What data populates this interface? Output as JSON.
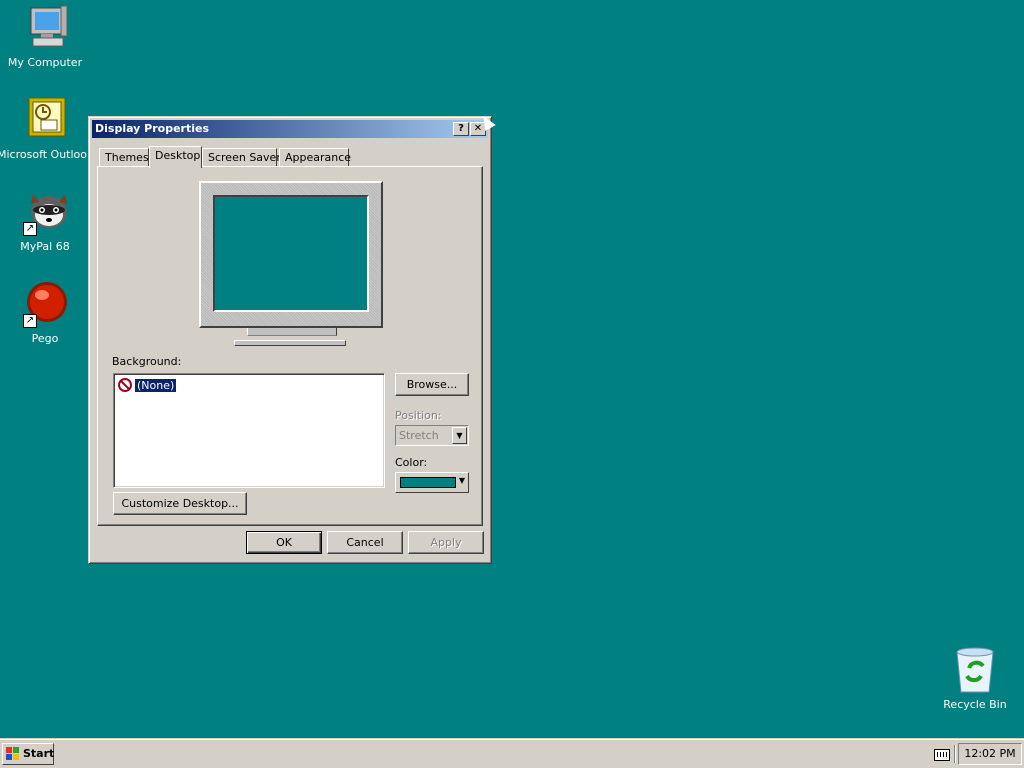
{
  "desktop": {
    "icons": [
      {
        "label": "My Computer",
        "icon": "my-computer-icon"
      },
      {
        "label": "Microsoft Outlook",
        "icon": "outlook-icon"
      },
      {
        "label": "MyPal 68",
        "icon": "mypal-icon"
      },
      {
        "label": "Pego",
        "icon": "pego-icon"
      },
      {
        "label": "Recycle Bin",
        "icon": "recycle-bin-icon"
      }
    ]
  },
  "window": {
    "title": "Display Properties",
    "help_glyph": "?",
    "close_glyph": "✕",
    "tabs": [
      "Themes",
      "Desktop",
      "Screen Saver",
      "Appearance"
    ],
    "active_tab": "Desktop",
    "background_label": "Background:",
    "background_items": [
      "(None)"
    ],
    "browse_label": "Browse...",
    "position_label": "Position:",
    "position_value": "Stretch",
    "color_label": "Color:",
    "color_value": "#008080",
    "customize_label": "Customize Desktop...",
    "ok_label": "OK",
    "cancel_label": "Cancel",
    "apply_label": "Apply"
  },
  "taskbar": {
    "start_label": "Start",
    "clock": "12:02 PM"
  },
  "colors": {
    "desktop": "#008080",
    "titlebar_start": "#0a246a",
    "titlebar_end": "#a6caf0",
    "face": "#d4d0c8"
  }
}
